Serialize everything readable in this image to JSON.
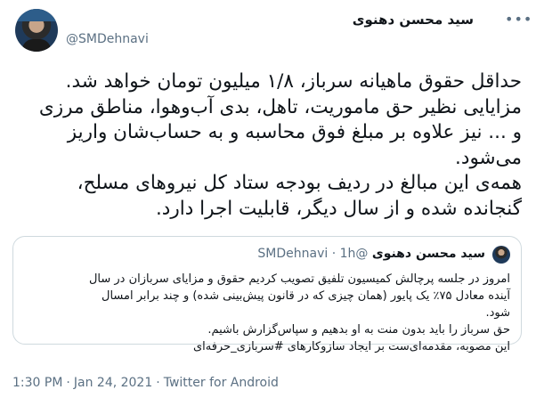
{
  "author": {
    "name": "سید محسن دهنوی",
    "handle": "@SMDehnavi"
  },
  "tweet": {
    "text": "حداقل حقوق ماهیانه سرباز، ۱/۸ میلیون تومان خواهد شد.\nمزایایی نظیر حق ماموریت، تاهل، بدی آب‌وهوا، مناطق مرزی\nو ... نیز علاوه بر مبلغ فوق محاسبه و به حساب‌شان واریز\nمی‌شود.\nهمه‌ی این مبالغ در ردیف بودجه ستاد کل نیروهای مسلح،\nگنجانده شده و از سال دیگر، قابلیت اجرا دارد."
  },
  "quoted_tweet": {
    "name": "سید محسن دهنوی",
    "handle": "@SMDehnavi",
    "dot": "·",
    "time": "1h",
    "text": "امروز در جلسه پرچالش کمیسیون تلفیق تصویب کردیم حقوق و مزایای سربازان در سال\nآینده معادل ۷۵٪ یک پایور (همان چیزی که در قانون پیش‌بینی شده) و چند برابر امسال\nشود.\nحق سرباز را باید بدون منت به او بدهیم و سپاس‌گزارش باشیم.\nاین مصوبه، مقدمه‌ای‌ست بر ایجاد سازوکارهای #سربازی_حرفه‌ای"
  },
  "meta": {
    "time": "1:30 PM",
    "sep1": "·",
    "date": "Jan 24, 2021",
    "sep2": "·",
    "source": "Twitter for Android"
  },
  "icons": {
    "more": "more-horizontal-icon"
  }
}
